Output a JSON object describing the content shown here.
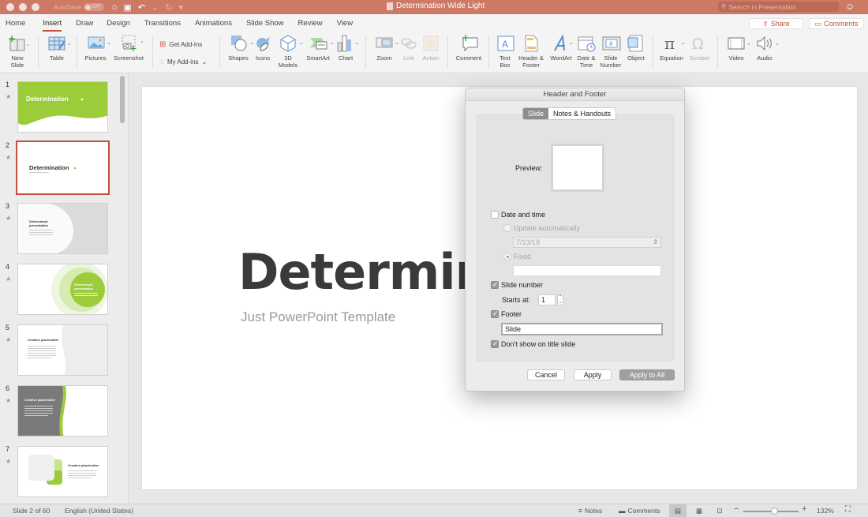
{
  "titlebar": {
    "autosave_label": "AutoSave",
    "autosave_state": "OFF",
    "document_title": "Determination Wide Light",
    "search_placeholder": "Search in Presentation"
  },
  "tabs": [
    {
      "label": "Home",
      "active": false
    },
    {
      "label": "Insert",
      "active": true
    },
    {
      "label": "Draw",
      "active": false
    },
    {
      "label": "Design",
      "active": false
    },
    {
      "label": "Transitions",
      "active": false
    },
    {
      "label": "Animations",
      "active": false
    },
    {
      "label": "Slide Show",
      "active": false
    },
    {
      "label": "Review",
      "active": false
    },
    {
      "label": "View",
      "active": false
    }
  ],
  "share_label": "Share",
  "comments_label": "Comments",
  "ribbon": {
    "new_slide": "New\nSlide",
    "table": "Table",
    "pictures": "Pictures",
    "screenshot": "Screenshot",
    "get_addins": "Get Add-ins",
    "my_addins": "My Add-ins",
    "shapes": "Shapes",
    "icons": "Icons",
    "models_3d": "3D\nModels",
    "smartart": "SmartArt",
    "chart": "Chart",
    "zoom": "Zoom",
    "link": "Link",
    "action": "Action",
    "comment": "Comment",
    "text_box": "Text\nBox",
    "header_footer": "Header &\nFooter",
    "wordart": "WordArt",
    "date_time": "Date &\nTime",
    "slide_number": "Slide\nNumber",
    "object": "Object",
    "equation": "Equation",
    "symbol": "Symbol",
    "video": "Video",
    "audio": "Audio"
  },
  "accent_color": "#c4503a",
  "thumbnails": [
    {
      "number": "1",
      "title": "Determination",
      "selected": false
    },
    {
      "number": "2",
      "title": "Determination",
      "selected": true
    },
    {
      "number": "3",
      "title": "Determinant presentation",
      "selected": false
    },
    {
      "number": "4",
      "title": "Determinant presentation",
      "selected": false
    },
    {
      "number": "5",
      "title": "Creative placeholder",
      "selected": false
    },
    {
      "number": "6",
      "title": "Creative placeholder",
      "selected": false
    },
    {
      "number": "7",
      "title": "Creative placeholder",
      "selected": false
    }
  ],
  "slide": {
    "title": "Determination",
    "subtitle": "Just PowerPoint Template"
  },
  "dialog": {
    "title": "Header and Footer",
    "tab_slide": "Slide",
    "tab_notes": "Notes & Handouts",
    "preview_label": "Preview:",
    "date_time_label": "Date and time",
    "date_time_checked": false,
    "update_auto_label": "Update automatically",
    "date_value": "7/13/19",
    "fixed_label": "Fixed",
    "fixed_value": "",
    "slide_number_label": "Slide number",
    "slide_number_checked": true,
    "starts_at_label": "Starts at:",
    "starts_at_value": "1",
    "footer_label": "Footer",
    "footer_checked": true,
    "footer_value": "Slide",
    "dont_show_label": "Don't show on title slide",
    "dont_show_checked": true,
    "cancel": "Cancel",
    "apply": "Apply",
    "apply_all": "Apply to All"
  },
  "status": {
    "slide_info": "Slide 2 of 60",
    "language": "English (United States)",
    "notes": "Notes",
    "comments": "Comments",
    "zoom_level": "132%"
  }
}
